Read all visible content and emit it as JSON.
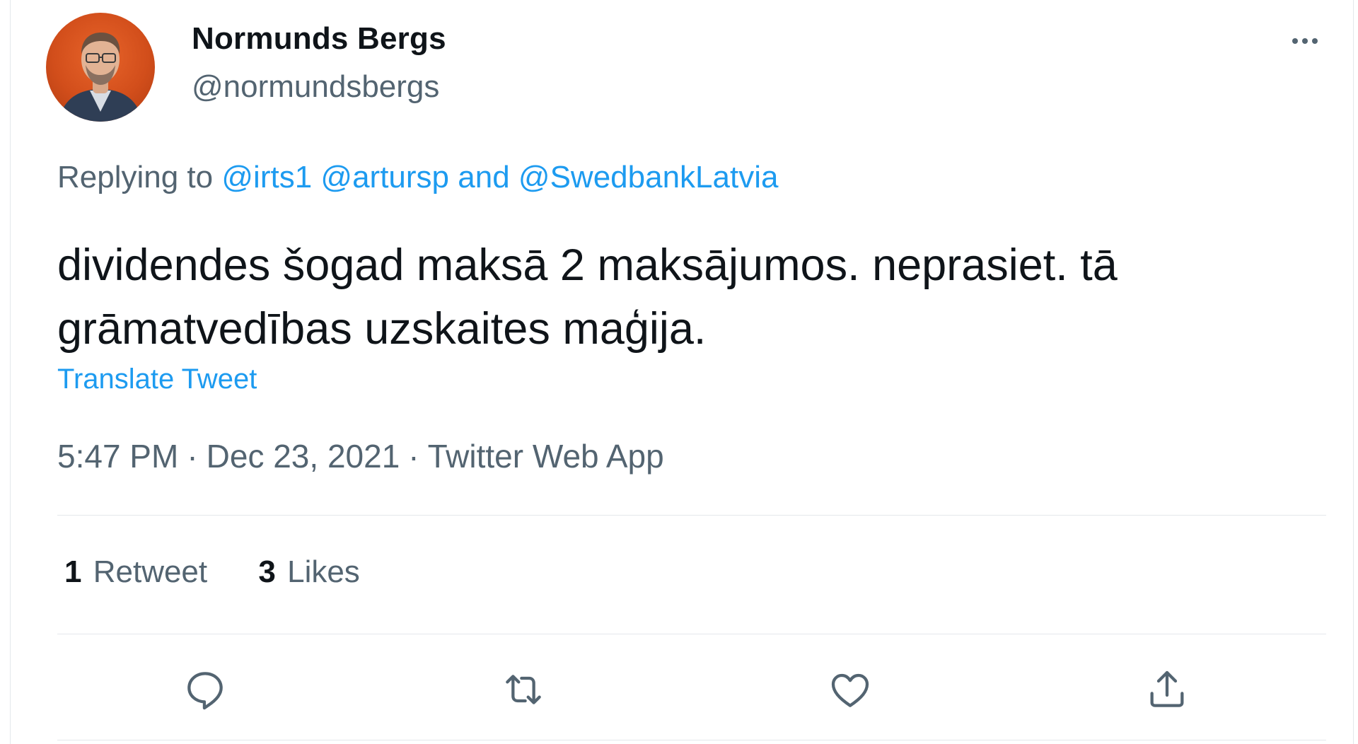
{
  "author": {
    "name": "Normunds Bergs",
    "handle": "@normundsbergs",
    "avatar_icon": "user-avatar-photo"
  },
  "more_icon": "more-options-icon",
  "reply": {
    "prefix": "Replying to",
    "mentions": [
      "@irts1",
      "@artursp",
      "@SwedbankLatvia"
    ],
    "conjunction": "and"
  },
  "tweet": {
    "text": "dividendes šogad maksā 2 maksājumos. neprasiet. tā grāmatvedības uzskaites maģija.",
    "translate_label": "Translate Tweet"
  },
  "meta": {
    "time": "5:47 PM",
    "separator": "·",
    "date": "Dec 23, 2021",
    "source": "Twitter Web App"
  },
  "stats": {
    "retweets_count": "1",
    "retweets_label": "Retweet",
    "likes_count": "3",
    "likes_label": "Likes"
  },
  "actions": [
    {
      "icon": "reply-icon"
    },
    {
      "icon": "retweet-icon"
    },
    {
      "icon": "like-icon"
    },
    {
      "icon": "share-icon"
    }
  ],
  "colors": {
    "link": "#1d9bf0",
    "secondary_text": "#536471",
    "primary_text": "#0f1419",
    "divider": "#e4e8eb"
  }
}
